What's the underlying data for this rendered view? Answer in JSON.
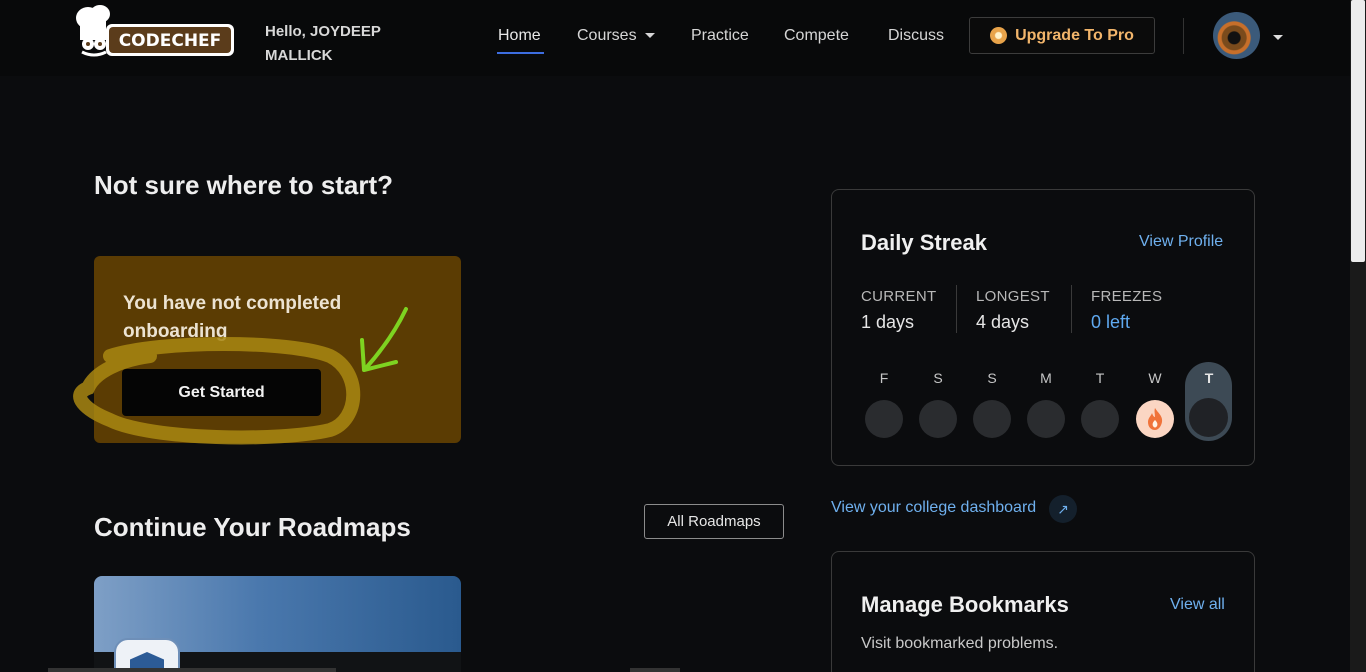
{
  "header": {
    "greeting": "Hello, JOYDEEP MALLICK",
    "nav": {
      "home": "Home",
      "courses": "Courses",
      "practice": "Practice",
      "compete": "Compete",
      "discuss": "Discuss"
    },
    "upgrade_label": "Upgrade To Pro",
    "logo_text": "CODECHEF"
  },
  "main": {
    "start_title": "Not sure where to start?",
    "onboarding_text": "You have not completed onboarding",
    "get_started_label": "Get Started",
    "roadmaps_title": "Continue Your Roadmaps",
    "all_roadmaps_label": "All Roadmaps"
  },
  "streak": {
    "title": "Daily Streak",
    "view_profile": "View Profile",
    "current_label": "CURRENT",
    "current_value": "1 days",
    "longest_label": "LONGEST",
    "longest_value": "4 days",
    "freezes_label": "FREEZES",
    "freezes_value": "0 left",
    "days": [
      "F",
      "S",
      "S",
      "M",
      "T",
      "W",
      "T"
    ],
    "active_day_index": 5,
    "today_index": 6
  },
  "college_link": "View your college dashboard",
  "bookmarks": {
    "title": "Manage Bookmarks",
    "view_all": "View all",
    "desc": "Visit bookmarked problems."
  },
  "colors": {
    "accent_blue": "#6fb0ee",
    "onboard_bg": "#5b3c03",
    "upgrade_text": "#f2b56b",
    "annotation_yellow": "#a98712",
    "annotation_green": "#7ed321"
  }
}
